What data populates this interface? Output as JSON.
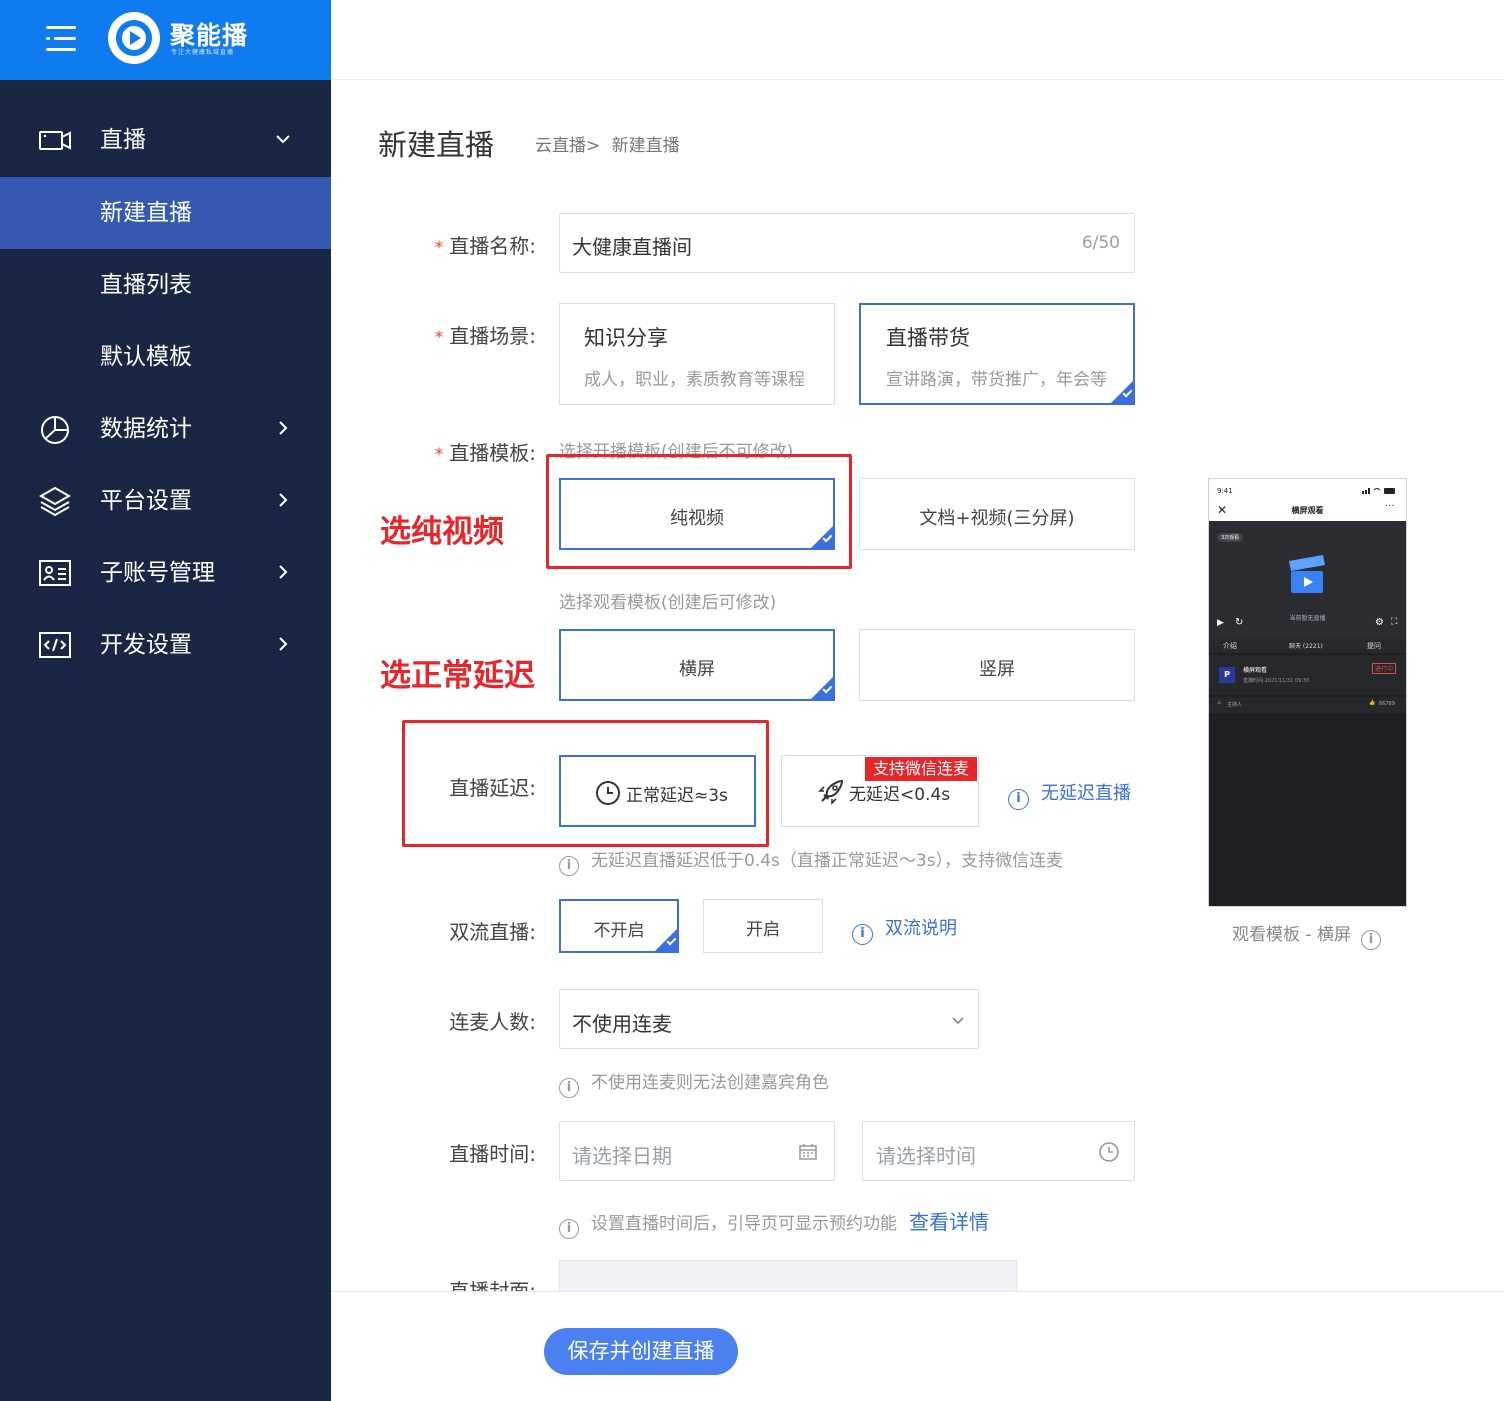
{
  "brand": {
    "name": "聚能播",
    "slogan": "专注大健康私域直播"
  },
  "sidebar": {
    "items": [
      {
        "label": "直播",
        "icon": "video-camera-icon"
      },
      {
        "label": "数据统计",
        "icon": "pie-chart-icon"
      },
      {
        "label": "平台设置",
        "icon": "layers-icon"
      },
      {
        "label": "子账号管理",
        "icon": "id-card-icon"
      },
      {
        "label": "开发设置",
        "icon": "code-icon"
      }
    ],
    "sub_items": [
      {
        "label": "新建直播",
        "active": true
      },
      {
        "label": "直播列表"
      },
      {
        "label": "默认模板"
      }
    ]
  },
  "page": {
    "title": "新建直播",
    "breadcrumb": [
      "云直播",
      ">",
      "新建直播"
    ]
  },
  "form": {
    "name": {
      "label": "直播名称:",
      "value": "大健康直播间",
      "count": "6/50"
    },
    "scene": {
      "label": "直播场景:",
      "options": [
        {
          "title": "知识分享",
          "desc": "成人，职业，素质教育等课程",
          "selected": false
        },
        {
          "title": "直播带货",
          "desc": "宣讲路演，带货推广，年会等",
          "selected": true
        }
      ]
    },
    "template": {
      "label": "直播模板:",
      "broadcast_hint": "选择开播模板(创建后不可修改)",
      "broadcast_options": [
        "纯视频",
        "文档+视频(三分屏)"
      ],
      "watch_hint": "选择观看模板(创建后可修改)",
      "watch_options": [
        "横屏",
        "竖屏"
      ]
    },
    "delay": {
      "label": "直播延迟:",
      "normal": "正常延迟≈3s",
      "zero": "无延迟<0.4s",
      "badge": "支持微信连麦",
      "link": "无延迟直播",
      "hint": "无延迟直播延迟低于0.4s（直播正常延迟～3s），支持微信连麦"
    },
    "dual": {
      "label": "双流直播:",
      "off": "不开启",
      "on": "开启",
      "link": "双流说明"
    },
    "mic": {
      "label": "连麦人数:",
      "value": "不使用连麦",
      "hint": "不使用连麦则无法创建嘉宾角色"
    },
    "time": {
      "label": "直播时间:",
      "date_placeholder": "请选择日期",
      "time_placeholder": "请选择时间",
      "hint": "设置直播时间后，引导页可显示预约功能",
      "link": "查看详情"
    },
    "cover": {
      "label": "直播封面:"
    }
  },
  "annotations": {
    "pick_video": "选纯视频",
    "pick_delay": "选正常延迟"
  },
  "preview": {
    "time": "9:41",
    "title": "横屏观看",
    "more": "···",
    "viewers": "3次观看",
    "no_live": "当前暂无直播",
    "tabs": [
      "介绍",
      "聊天 (2221)",
      "提问"
    ],
    "room_name": "横屏观看",
    "room_time": "直播时间 2021/11/31 09:30",
    "state": "进行中",
    "host": "主持人",
    "likes": "66789",
    "caption": "观看模板 - 横屏"
  },
  "actions": {
    "save": "保存并创建直播"
  },
  "colors": {
    "brand": "#0e7bef",
    "sidebar": "#1a2744",
    "accent": "#3a6fe0",
    "annotation": "#e8262a"
  }
}
